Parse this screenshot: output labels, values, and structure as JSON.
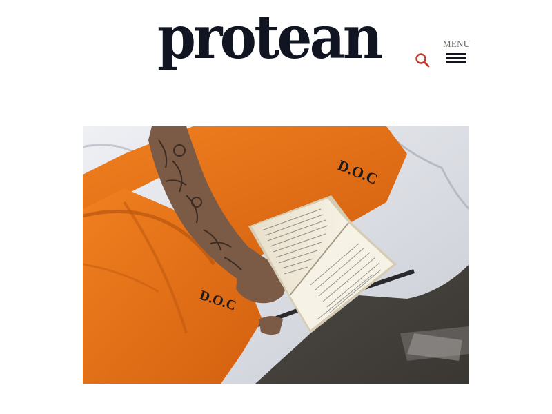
{
  "header": {
    "logo_text": "protean",
    "menu_label": "MENU",
    "search_icon": "search-icon",
    "menu_icon": "hamburger-icon"
  },
  "colors": {
    "logo": "#111522",
    "search_accent": "#c0392b",
    "menu_label": "#6b6b6b",
    "jumpsuit": "#e8731a",
    "background": "#ffffff"
  },
  "hero_image": {
    "jumpsuit_print_top": "D.O.C",
    "jumpsuit_print_leg": "D.O.C"
  }
}
